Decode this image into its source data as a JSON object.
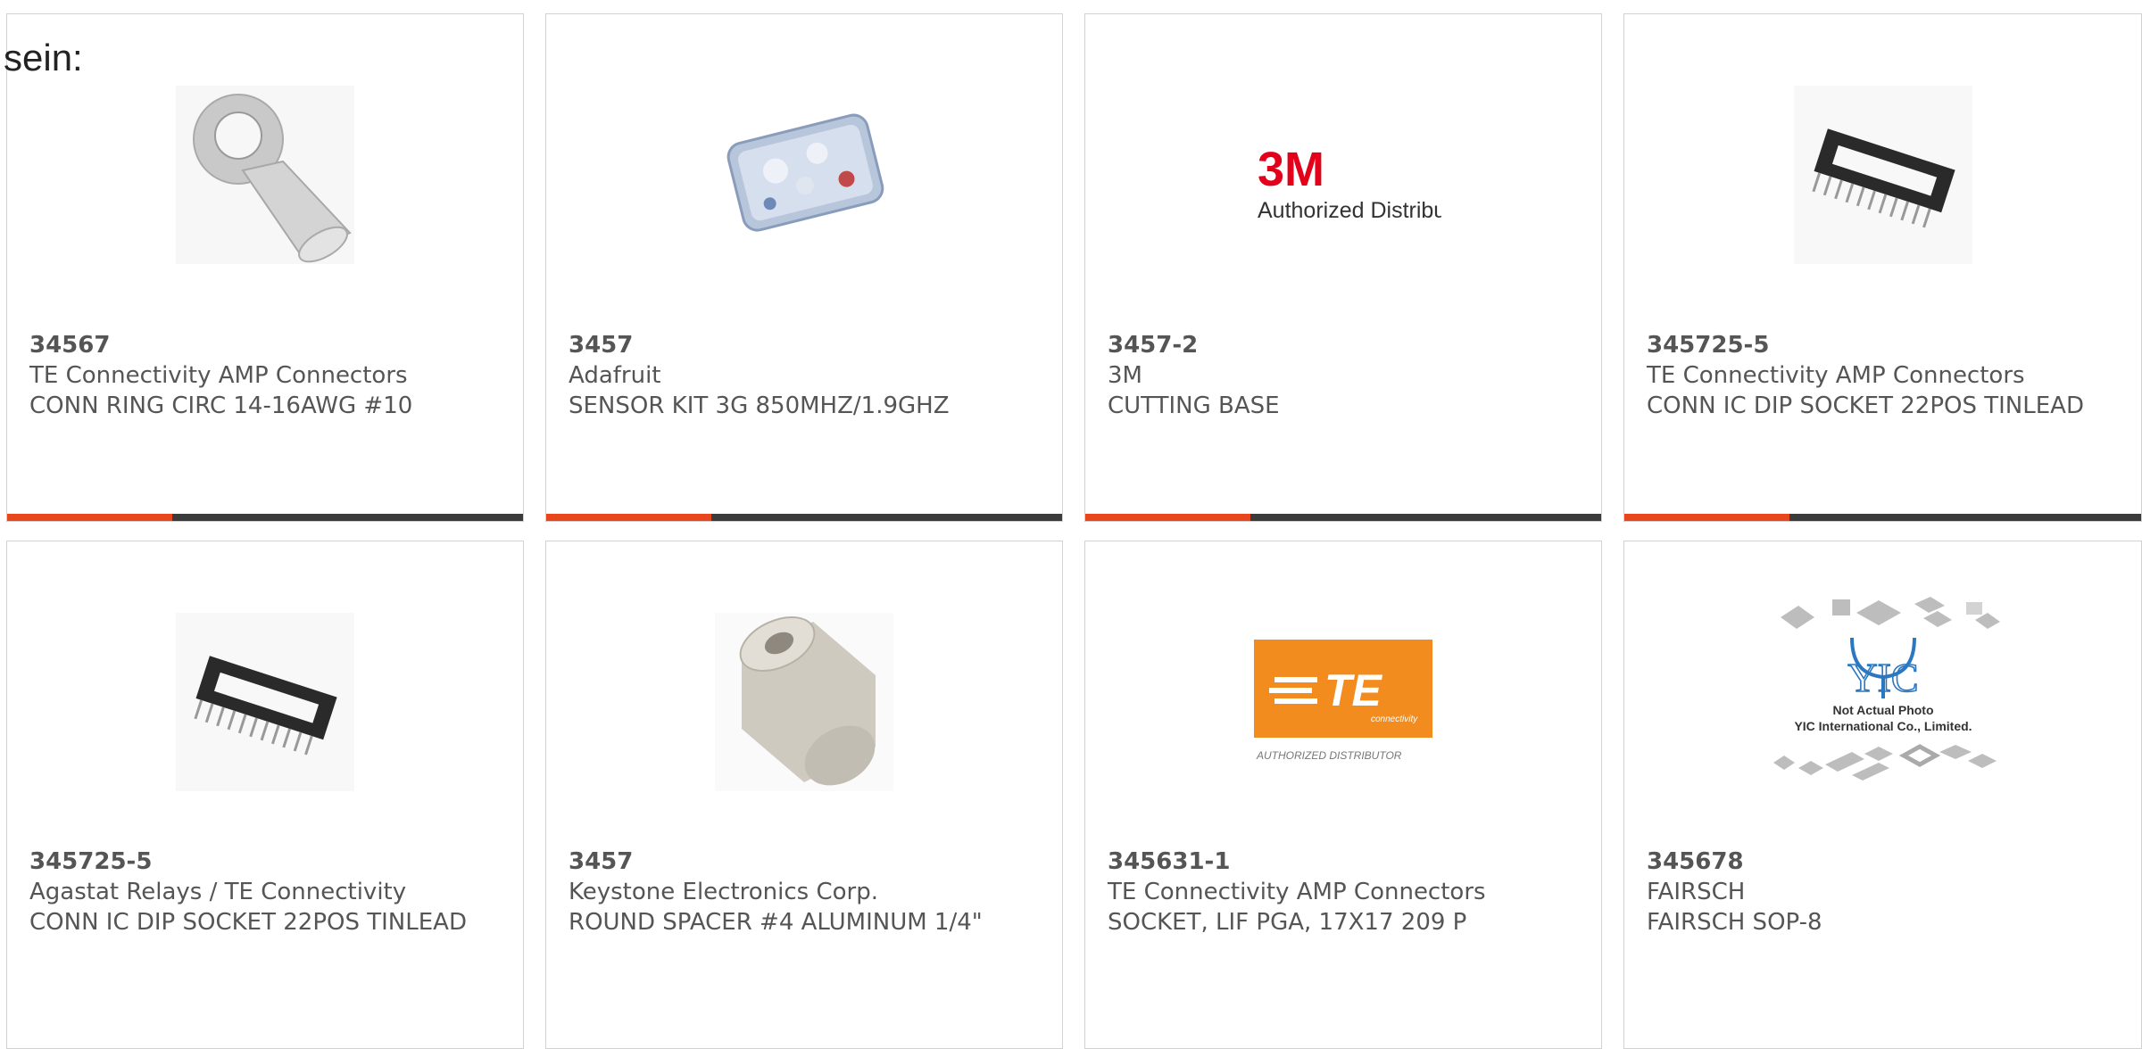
{
  "page_prefix": "sein:",
  "colors": {
    "accent": "#e8461c",
    "bar": "#3b3b3b",
    "text": "#555555",
    "border": "#d2d2d2"
  },
  "products": [
    {
      "part_number": "34567",
      "manufacturer": "TE Connectivity AMP Connectors",
      "description": "CONN RING CIRC 14-16AWG #10",
      "image": "ring-terminal-image"
    },
    {
      "part_number": "3457",
      "manufacturer": "Adafruit",
      "description": "SENSOR KIT 3G 850MHZ/1.9GHZ",
      "image": "sensor-kit-box-image"
    },
    {
      "part_number": "3457-2",
      "manufacturer": "3M",
      "description": "CUTTING BASE",
      "image": "3m-logo",
      "logo_text": "3M",
      "logo_subtext": "Authorized Distributor"
    },
    {
      "part_number": "345725-5",
      "manufacturer": "TE Connectivity AMP Connectors",
      "description": "CONN IC DIP SOCKET 22POS TINLEAD",
      "image": "dip-socket-image"
    },
    {
      "part_number": "345725-5",
      "manufacturer": "Agastat Relays / TE Connectivity",
      "description": "CONN IC DIP SOCKET 22POS TINLEAD",
      "image": "dip-socket-image"
    },
    {
      "part_number": "3457",
      "manufacturer": "Keystone Electronics Corp.",
      "description": "ROUND SPACER #4 ALUMINUM 1/4\"",
      "image": "round-spacer-image"
    },
    {
      "part_number": "345631-1",
      "manufacturer": "TE Connectivity AMP Connectors",
      "description": "SOCKET, LIF PGA, 17X17 209 P",
      "image": "te-logo",
      "logo_text": "TE",
      "logo_subtext": "connectivity",
      "logo_caption": "AUTHORIZED DISTRIBUTOR"
    },
    {
      "part_number": "345678",
      "manufacturer": "FAIRSCH",
      "description": "FAIRSCH SOP-8",
      "image": "yic-placeholder",
      "logo_text": "YIC",
      "logo_caption": "Not Actual Photo",
      "logo_caption2": "YIC International Co., Limited."
    }
  ],
  "accent_fraction": 0.32
}
